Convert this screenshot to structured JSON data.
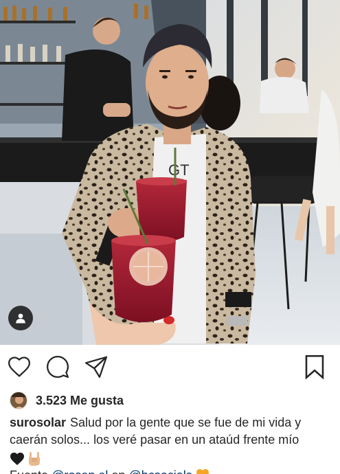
{
  "post": {
    "photo_alt": "",
    "likes": {
      "count": "3.523",
      "label": "Me gusta"
    },
    "caption": {
      "username": "surosolar",
      "line1": "Salud por la gente que se fue de mi vida y",
      "line2": "caerán solos... los veré pasar en un ataúd frente mío",
      "emojis": [
        "black-heart-icon",
        "rock-on-hand-icon"
      ]
    },
    "source": {
      "prefix": "Fuente",
      "mention1": "@rosep el",
      "word": "en",
      "mention2": "@bcsocials",
      "emoji": "orange-heart-icon"
    },
    "icons": {
      "like": "heart-outline-icon",
      "comment": "speech-bubble-icon",
      "share": "paper-plane-icon",
      "save": "bookmark-icon",
      "tags": "person-tag-icon"
    }
  }
}
